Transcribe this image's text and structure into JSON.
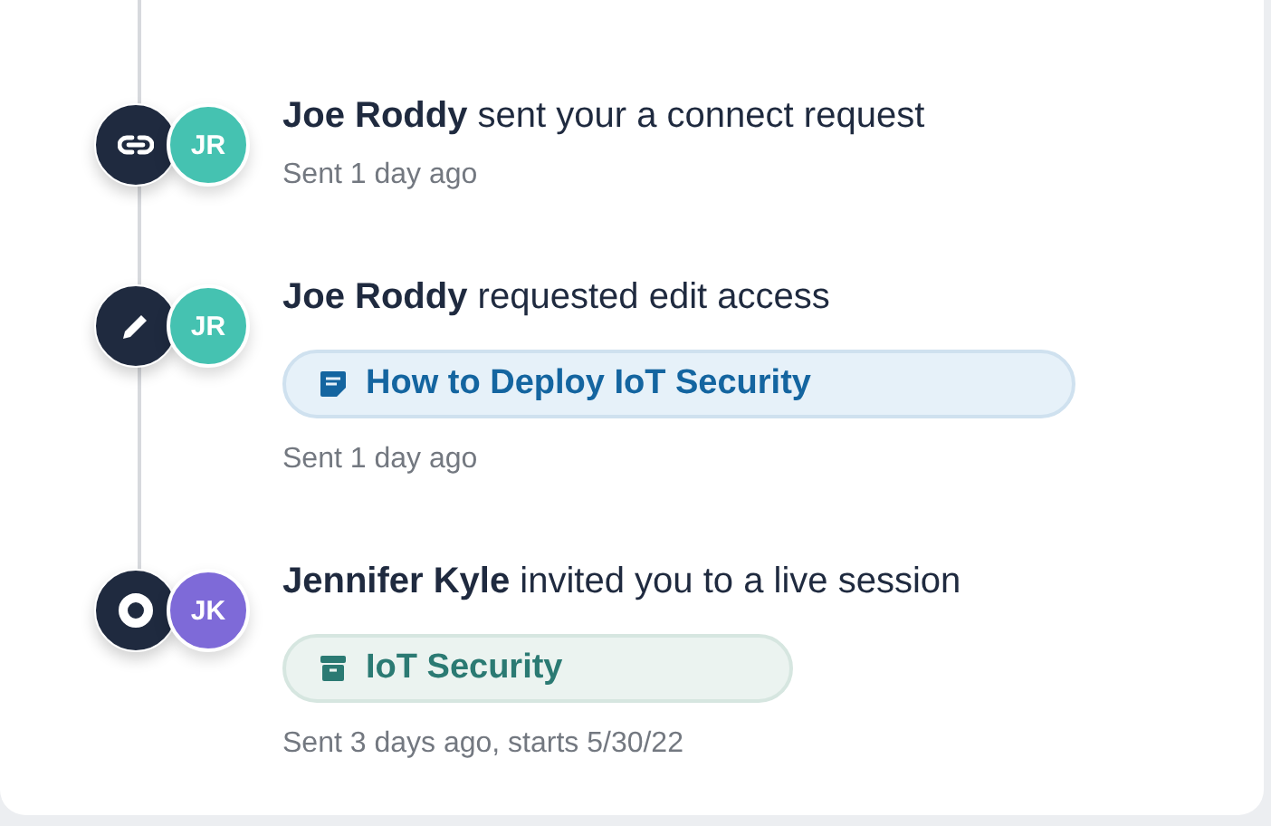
{
  "activities": [
    {
      "kind": "link",
      "avatar": {
        "initials": "JR",
        "color": "#45c2b1"
      },
      "sentence": "**Joe Roddy** sent your a connect request",
      "meta": "Sent 1 day ago"
    },
    {
      "kind": "edit",
      "avatar": {
        "initials": "JR",
        "color": "#45c2b1"
      },
      "sentence": "**Joe Roddy** requested edit access",
      "chip": {
        "kind": "document",
        "label": "How to Deploy IoT Security"
      },
      "meta": "Sent 1 day ago"
    },
    {
      "kind": "live",
      "avatar": {
        "initials": "JK",
        "color": "#7e6ad8"
      },
      "sentence": "**Jennifer Kyle** invited you to a live session",
      "chip": {
        "kind": "archive",
        "label": "IoT Security"
      },
      "meta": "Sent 3 days ago, starts 5/30/22"
    }
  ]
}
